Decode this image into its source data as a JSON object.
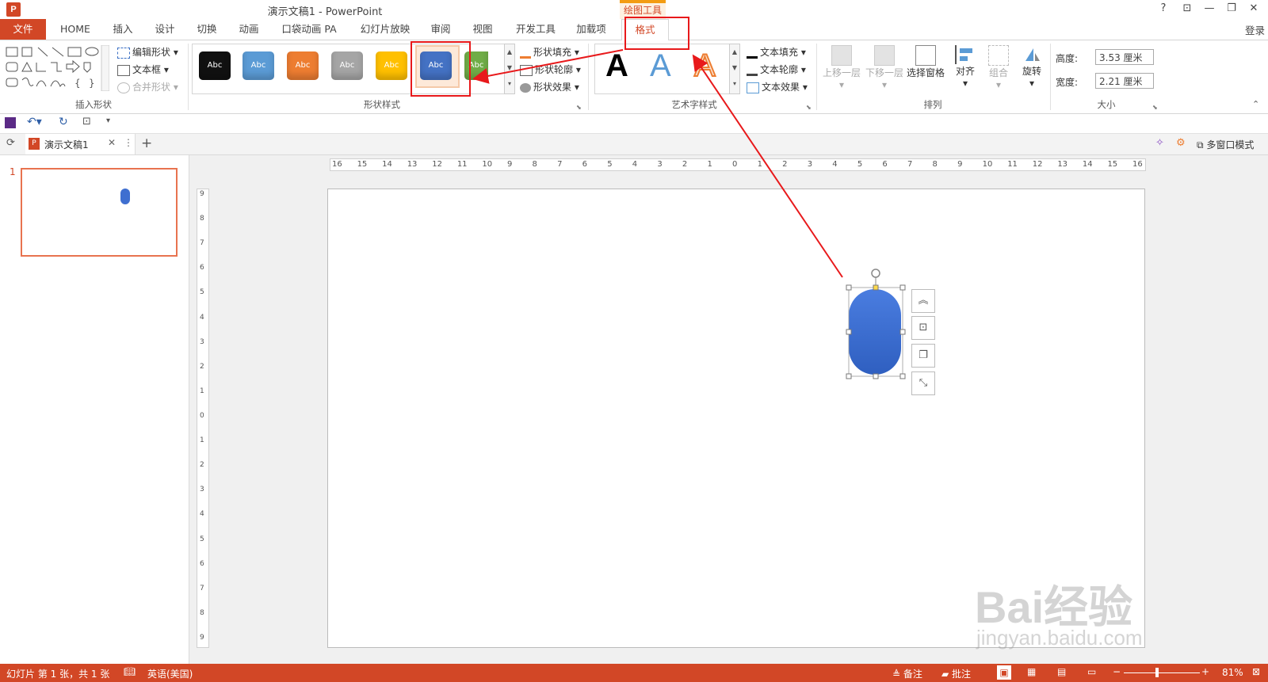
{
  "window": {
    "title": "演示文稿1 - PowerPoint",
    "context_label": "绘图工具",
    "help": "?",
    "controls": [
      "⊡",
      "—",
      "❐",
      "✕"
    ]
  },
  "tabs": [
    {
      "label": "文件"
    },
    {
      "label": "HOME"
    },
    {
      "label": "插入"
    },
    {
      "label": "设计"
    },
    {
      "label": "切换"
    },
    {
      "label": "动画"
    },
    {
      "label": "口袋动画 PA"
    },
    {
      "label": "幻灯片放映"
    },
    {
      "label": "审阅"
    },
    {
      "label": "视图"
    },
    {
      "label": "开发工具"
    },
    {
      "label": "加载项"
    },
    {
      "label": "格式"
    }
  ],
  "login": "登录",
  "ribbon": {
    "insert_shapes": {
      "edit_shape": "编辑形状",
      "textbox": "文本框",
      "merge_shapes": "合并形状",
      "group_label": "插入形状"
    },
    "shape_styles": {
      "swatches": [
        {
          "text": "Abc",
          "color": "#111111"
        },
        {
          "text": "Abc",
          "color": "#5b9bd5"
        },
        {
          "text": "Abc",
          "color": "#ed7d31"
        },
        {
          "text": "Abc",
          "color": "#a5a5a5"
        },
        {
          "text": "Abc",
          "color": "#ffc000"
        },
        {
          "text": "Abc",
          "color": "#4472c4"
        },
        {
          "text": "Abc",
          "color": "#70ad47"
        }
      ],
      "fill": "形状填充",
      "outline": "形状轮廓",
      "effects": "形状效果",
      "group_label": "形状样式"
    },
    "wordart": {
      "letters": [
        "A",
        "A",
        "A"
      ],
      "text_fill": "文本填充",
      "text_outline": "文本轮廓",
      "text_effects": "文本效果",
      "group_label": "艺术字样式"
    },
    "arrange": {
      "bring_forward": "上移一层",
      "send_backward": "下移一层",
      "selection_pane": "选择窗格",
      "align": "对齐",
      "group": "组合",
      "rotate": "旋转",
      "group_label": "排列"
    },
    "size": {
      "height_label": "高度:",
      "height_value": "3.53 厘米",
      "width_label": "宽度:",
      "width_value": "2.21 厘米",
      "group_label": "大小"
    }
  },
  "document_tab": {
    "name": "演示文稿1",
    "multiwindow": "多窗口模式"
  },
  "thumbnails": [
    {
      "number": "1"
    }
  ],
  "ruler": {
    "horizontal": [
      "16",
      "15",
      "14",
      "13",
      "12",
      "11",
      "10",
      "9",
      "8",
      "7",
      "6",
      "5",
      "4",
      "3",
      "2",
      "1",
      "0",
      "1",
      "2",
      "3",
      "4",
      "5",
      "6",
      "7",
      "8",
      "9",
      "10",
      "11",
      "12",
      "13",
      "14",
      "15",
      "16"
    ],
    "vertical": [
      "9",
      "8",
      "7",
      "6",
      "5",
      "4",
      "3",
      "2",
      "1",
      "0",
      "1",
      "2",
      "3",
      "4",
      "5",
      "6",
      "7",
      "8",
      "9"
    ]
  },
  "status": {
    "slide_info": "幻灯片 第 1 张，共 1 张",
    "language": "英语(美国)",
    "notes": "备注",
    "comments": "批注",
    "zoom": "81%"
  },
  "watermark": {
    "brand": "Bai经验",
    "url": "jingyan.baidu.com"
  },
  "colors": {
    "accent": "#d24726",
    "shape_fill": "#3f6fd0",
    "annotation_red": "#e8191b"
  }
}
